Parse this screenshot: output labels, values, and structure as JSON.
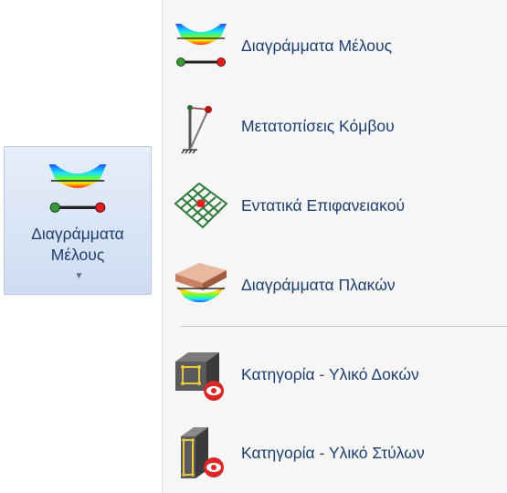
{
  "ribbon_button": {
    "label_line1": "Διαγράμματα",
    "label_line2": "Μέλους",
    "icon": "member-diagram-icon"
  },
  "dropdown_menu": {
    "items": [
      {
        "label": "Διαγράμματα Μέλους",
        "icon": "member-diagram-icon"
      },
      {
        "label": "Μετατοπίσεις Κόμβου",
        "icon": "node-displacement-icon"
      },
      {
        "label": "Εντατικά Επιφανειακού",
        "icon": "surface-mesh-icon"
      },
      {
        "label": "Διαγράμματα Πλακών",
        "icon": "slab-diagram-icon"
      },
      {
        "label": "Κατηγορία - Υλικό Δοκών",
        "icon": "beam-material-icon"
      },
      {
        "label": "Κατηγορία - Υλικό Στύλων",
        "icon": "column-material-icon"
      }
    ]
  }
}
